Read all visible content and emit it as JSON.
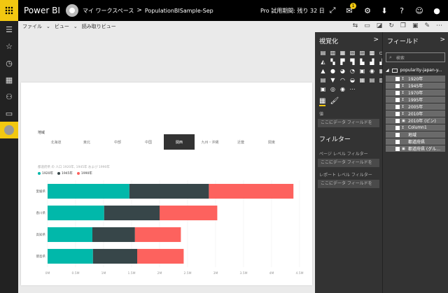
{
  "topbar": {
    "brand": "Power BI",
    "workspace": "マイ ワークスペース",
    "separator": ">",
    "report": "PopulationBISample-Sep",
    "trial": "Pro 試用期間: 残り 32 日",
    "notification_count": "1"
  },
  "toolbar": {
    "file": "ファイル",
    "view": "ビュー",
    "reading_view": "読み取りビュー"
  },
  "slicer": {
    "title": "地域",
    "tiles": [
      "北海道",
      "東北",
      "中部",
      "中国",
      "関西",
      "九州・沖縄",
      "近畿",
      "関東"
    ],
    "selected": "関西"
  },
  "chart_title": "都道府県 の 人口 1920年, 1945年 および 1990年",
  "chart_data": {
    "type": "bar",
    "orientation": "horizontal",
    "stacked": true,
    "categories": [
      "愛媛県",
      "香川県",
      "高知県",
      "徳島県"
    ],
    "series": [
      {
        "name": "1920年",
        "color": "#01b8aa",
        "values": [
          1.46,
          1.01,
          0.8,
          0.81
        ]
      },
      {
        "name": "1945年",
        "color": "#374649",
        "values": [
          1.42,
          0.99,
          0.76,
          0.79
        ]
      },
      {
        "name": "1990年",
        "color": "#fd625e",
        "values": [
          1.51,
          1.03,
          0.82,
          0.83
        ]
      }
    ],
    "xlim": [
      0,
      4.5
    ],
    "xticks": [
      "0M",
      "0.5M",
      "1M",
      "1.5M",
      "2M",
      "2.5M",
      "3M",
      "3.5M",
      "4M",
      "4.5M"
    ],
    "grid": true,
    "legend": "top-left"
  },
  "viz_pane": {
    "title": "視覚化",
    "collapse": ">",
    "icons": [
      "▤",
      "▥",
      "▦",
      "▧",
      "▨",
      "▩",
      "▭",
      "◭",
      "▚",
      "▛",
      "▜",
      "▙",
      "▟",
      "▞",
      "▲",
      "●",
      "◕",
      "◔",
      "▣",
      "◉",
      "▦",
      "▤",
      "▼",
      "◠",
      "◒",
      "▦",
      "▤",
      "▥",
      "▣",
      "◎",
      "◉",
      "⋯"
    ],
    "section_label": "値",
    "dropzone": "ここにデータ フィールドを",
    "filter_title": "フィルター",
    "page_filter": "ページ レベル フィルター",
    "report_filter": "レポート レベル フィルター"
  },
  "fields_pane": {
    "title": "フィールド",
    "collapse": ">",
    "search_placeholder": "検索",
    "table": "popularity-japan-y...",
    "items": [
      {
        "sigma": "Σ",
        "label": "1920年"
      },
      {
        "sigma": "Σ",
        "label": "1945年"
      },
      {
        "sigma": "Σ",
        "label": "1970年"
      },
      {
        "sigma": "Σ",
        "label": "1995年"
      },
      {
        "sigma": "Σ",
        "label": "2005年"
      },
      {
        "sigma": "Σ",
        "label": "2010年"
      },
      {
        "sigma": "▣",
        "label": "2010年 (ビン)"
      },
      {
        "sigma": "Σ",
        "label": "Column1"
      },
      {
        "sigma": "",
        "label": "地域"
      },
      {
        "sigma": "",
        "label": "都道府県"
      },
      {
        "sigma": "▣",
        "label": "都道府県 (グル..."
      }
    ]
  }
}
